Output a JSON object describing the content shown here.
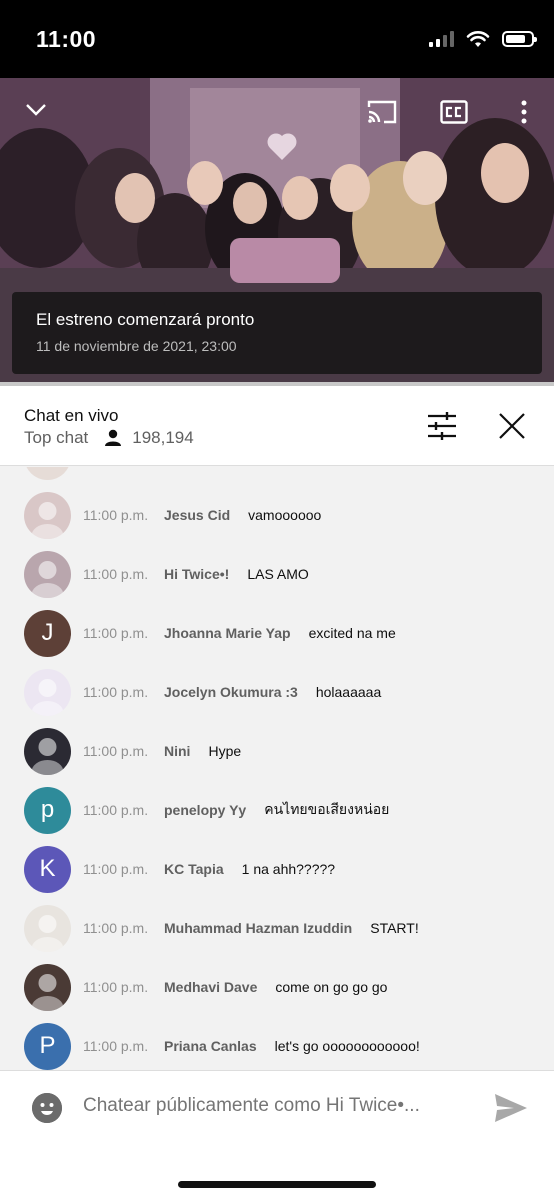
{
  "status_bar": {
    "time": "11:00",
    "battery_level": 0.8
  },
  "video": {
    "premiere_title": "El estreno comenzará pronto",
    "premiere_date": "11 de noviembre de 2021, 23:00",
    "icons": [
      "chevron-down-icon",
      "cast-icon",
      "captions-icon",
      "more-vertical-icon"
    ]
  },
  "chat_header": {
    "title": "Chat en vivo",
    "mode": "Top chat",
    "viewers": "198,194"
  },
  "messages": [
    {
      "time": "11:00 p.m.",
      "author": "Jesus Cid",
      "text": "vamoooooo",
      "avatar": "photo",
      "color": "#d9c7c7"
    },
    {
      "time": "11:00 p.m.",
      "author": "Hi Twice•!",
      "text": "LAS AMO",
      "avatar": "photo",
      "color": "#b9a6ad"
    },
    {
      "time": "11:00 p.m.",
      "author": "Jhoanna Marie Yap",
      "text": "excited na me",
      "avatar": "J",
      "color": "#5d4037"
    },
    {
      "time": "11:00 p.m.",
      "author": "Jocelyn Okumura :3",
      "text": "holaaaaaa",
      "avatar": "photo",
      "color": "#ece6f2"
    },
    {
      "time": "11:00 p.m.",
      "author": "Nini",
      "text": "Hype",
      "avatar": "photo",
      "color": "#2b2a33"
    },
    {
      "time": "11:00 p.m.",
      "author": "penelopy Yy",
      "text": "คนไทยขอเสียงหน่อย",
      "avatar": "p",
      "color": "#2e8b9a"
    },
    {
      "time": "11:00 p.m.",
      "author": "KC Tapia",
      "text": "1 na ahh?????",
      "avatar": "K",
      "color": "#5c57b8"
    },
    {
      "time": "11:00 p.m.",
      "author": "Muhammad Hazman Izuddin",
      "text": "START!",
      "avatar": "photo",
      "color": "#e8e4df"
    },
    {
      "time": "11:00 p.m.",
      "author": "Medhavi Dave",
      "text": "come on go go go",
      "avatar": "photo",
      "color": "#4a3a35"
    },
    {
      "time": "11:00 p.m.",
      "author": "Priana Canlas",
      "text": "let's go oooooooooooo!",
      "avatar": "P",
      "color": "#3a6fad"
    }
  ],
  "input": {
    "placeholder": "Chatear públicamente como Hi Twice•..."
  }
}
